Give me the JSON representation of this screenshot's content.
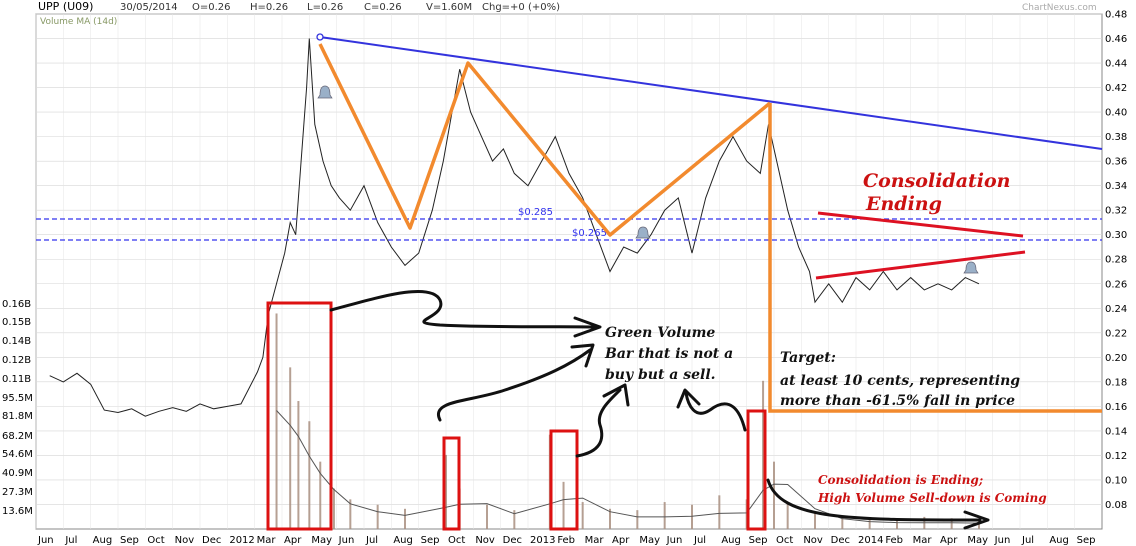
{
  "header": {
    "ticker": "UPP (U09)",
    "date": "30/05/2014",
    "open": "O=0.26",
    "high": "H=0.26",
    "low": "L=0.26",
    "close": "C=0.26",
    "volume": "V=1.60M",
    "change": "Chg=+0 (+0%)",
    "watermark": "ChartNexus.com",
    "indicator": "Volume MA (14d)"
  },
  "colors": {
    "price": "#222222",
    "volume_bar": "#a98f80",
    "volume_ma": "#555555",
    "trendline": "#3333dd",
    "support_line": "#3333ee",
    "pattern": "#f28a2e",
    "triangle": "#dd1122",
    "highlight_box": "#dd1111",
    "arrow": "#111111",
    "annotation_red": "#cc1111"
  },
  "annotations": {
    "level_285": "$0.285",
    "level_265": "$0.265",
    "consolidation_title_1": "Consolidation",
    "consolidation_title_2": "Ending",
    "green_volume_1": "Green Volume",
    "green_volume_2": "Bar that is not a",
    "green_volume_3": "buy but a sell.",
    "target_1": "Target:",
    "target_2": "at least 10 cents, representing",
    "target_3": "more than -61.5% fall in price",
    "bottom_note_1": "Consolidation is Ending;",
    "bottom_note_2": "High Volume Sell-down is Coming"
  },
  "chart_data": {
    "type": "line",
    "title": "UPP (U09)",
    "x_labels": [
      "Jun",
      "Jul",
      "Aug",
      "Sep",
      "Oct",
      "Nov",
      "Dec",
      "2012",
      "Mar",
      "Apr",
      "May",
      "Jun",
      "Jul",
      "Aug",
      "Sep",
      "Oct",
      "Nov",
      "Dec",
      "2013",
      "Feb",
      "Mar",
      "Apr",
      "May",
      "Jun",
      "Jul",
      "Aug",
      "Sep",
      "Oct",
      "Nov",
      "Dec",
      "2014",
      "Feb",
      "Mar",
      "Apr",
      "May",
      "Jun",
      "Jul",
      "Aug",
      "Sep"
    ],
    "price_axis": {
      "ticks": [
        "0.48",
        "0.46",
        "0.44",
        "0.42",
        "0.40",
        "0.38",
        "0.36",
        "0.34",
        "0.32",
        "0.30",
        "0.28",
        "0.26",
        "0.24",
        "0.22",
        "0.20",
        "0.18",
        "0.16",
        "0.14",
        "0.12",
        "0.10",
        "0.08"
      ],
      "ylim": [
        0.06,
        0.48
      ]
    },
    "volume_axis": {
      "ticks": [
        "0.16B",
        "0.15B",
        "0.14B",
        "0.12B",
        "0.11B",
        "95.5M",
        "81.8M",
        "68.2M",
        "54.6M",
        "40.9M",
        "27.3M",
        "13.6M"
      ],
      "ylim": [
        0,
        170
      ]
    },
    "price_series": [
      {
        "x": 0,
        "y": 0.185
      },
      {
        "x": 0.5,
        "y": 0.18
      },
      {
        "x": 1,
        "y": 0.187
      },
      {
        "x": 1.5,
        "y": 0.178
      },
      {
        "x": 2,
        "y": 0.157
      },
      {
        "x": 2.5,
        "y": 0.155
      },
      {
        "x": 3,
        "y": 0.158
      },
      {
        "x": 3.5,
        "y": 0.152
      },
      {
        "x": 4,
        "y": 0.156
      },
      {
        "x": 4.5,
        "y": 0.159
      },
      {
        "x": 5,
        "y": 0.156
      },
      {
        "x": 5.5,
        "y": 0.162
      },
      {
        "x": 6,
        "y": 0.158
      },
      {
        "x": 6.5,
        "y": 0.16
      },
      {
        "x": 7,
        "y": 0.162
      },
      {
        "x": 7.3,
        "y": 0.175
      },
      {
        "x": 7.6,
        "y": 0.188
      },
      {
        "x": 7.8,
        "y": 0.2
      },
      {
        "x": 8,
        "y": 0.235
      },
      {
        "x": 8.3,
        "y": 0.26
      },
      {
        "x": 8.6,
        "y": 0.285
      },
      {
        "x": 8.8,
        "y": 0.31
      },
      {
        "x": 9,
        "y": 0.3
      },
      {
        "x": 9.2,
        "y": 0.36
      },
      {
        "x": 9.4,
        "y": 0.42
      },
      {
        "x": 9.5,
        "y": 0.46
      },
      {
        "x": 9.7,
        "y": 0.39
      },
      {
        "x": 10,
        "y": 0.36
      },
      {
        "x": 10.3,
        "y": 0.34
      },
      {
        "x": 10.6,
        "y": 0.33
      },
      {
        "x": 11,
        "y": 0.32
      },
      {
        "x": 11.5,
        "y": 0.34
      },
      {
        "x": 12,
        "y": 0.31
      },
      {
        "x": 12.5,
        "y": 0.29
      },
      {
        "x": 13,
        "y": 0.275
      },
      {
        "x": 13.5,
        "y": 0.285
      },
      {
        "x": 14,
        "y": 0.32
      },
      {
        "x": 14.4,
        "y": 0.36
      },
      {
        "x": 14.8,
        "y": 0.41
      },
      {
        "x": 15,
        "y": 0.435
      },
      {
        "x": 15.4,
        "y": 0.4
      },
      {
        "x": 15.8,
        "y": 0.38
      },
      {
        "x": 16.2,
        "y": 0.36
      },
      {
        "x": 16.6,
        "y": 0.37
      },
      {
        "x": 17,
        "y": 0.35
      },
      {
        "x": 17.5,
        "y": 0.34
      },
      {
        "x": 18,
        "y": 0.36
      },
      {
        "x": 18.5,
        "y": 0.38
      },
      {
        "x": 19,
        "y": 0.35
      },
      {
        "x": 19.5,
        "y": 0.33
      },
      {
        "x": 20,
        "y": 0.3
      },
      {
        "x": 20.5,
        "y": 0.27
      },
      {
        "x": 21,
        "y": 0.29
      },
      {
        "x": 21.5,
        "y": 0.285
      },
      {
        "x": 22,
        "y": 0.3
      },
      {
        "x": 22.5,
        "y": 0.32
      },
      {
        "x": 23,
        "y": 0.33
      },
      {
        "x": 23.5,
        "y": 0.285
      },
      {
        "x": 24,
        "y": 0.33
      },
      {
        "x": 24.5,
        "y": 0.36
      },
      {
        "x": 25,
        "y": 0.38
      },
      {
        "x": 25.5,
        "y": 0.36
      },
      {
        "x": 26,
        "y": 0.35
      },
      {
        "x": 26.3,
        "y": 0.39
      },
      {
        "x": 26.6,
        "y": 0.36
      },
      {
        "x": 27,
        "y": 0.32
      },
      {
        "x": 27.4,
        "y": 0.29
      },
      {
        "x": 27.8,
        "y": 0.27
      },
      {
        "x": 28,
        "y": 0.245
      },
      {
        "x": 28.5,
        "y": 0.26
      },
      {
        "x": 29,
        "y": 0.245
      },
      {
        "x": 29.5,
        "y": 0.265
      },
      {
        "x": 30,
        "y": 0.255
      },
      {
        "x": 30.5,
        "y": 0.27
      },
      {
        "x": 31,
        "y": 0.255
      },
      {
        "x": 31.5,
        "y": 0.265
      },
      {
        "x": 32,
        "y": 0.255
      },
      {
        "x": 32.5,
        "y": 0.26
      },
      {
        "x": 33,
        "y": 0.255
      },
      {
        "x": 33.5,
        "y": 0.265
      },
      {
        "x": 34,
        "y": 0.26
      }
    ],
    "volume_bars": [
      {
        "x": 8.3,
        "v": 160
      },
      {
        "x": 8.8,
        "v": 120
      },
      {
        "x": 9.1,
        "v": 95
      },
      {
        "x": 9.5,
        "v": 80
      },
      {
        "x": 9.9,
        "v": 50
      },
      {
        "x": 10.4,
        "v": 30
      },
      {
        "x": 11,
        "v": 22
      },
      {
        "x": 12,
        "v": 18
      },
      {
        "x": 13,
        "v": 15
      },
      {
        "x": 14.5,
        "v": 55
      },
      {
        "x": 15,
        "v": 30
      },
      {
        "x": 16,
        "v": 18
      },
      {
        "x": 17,
        "v": 14
      },
      {
        "x": 18.3,
        "v": 70
      },
      {
        "x": 18.8,
        "v": 35
      },
      {
        "x": 19.5,
        "v": 20
      },
      {
        "x": 20.5,
        "v": 15
      },
      {
        "x": 21.5,
        "v": 14
      },
      {
        "x": 22.5,
        "v": 20
      },
      {
        "x": 23.5,
        "v": 18
      },
      {
        "x": 24.5,
        "v": 25
      },
      {
        "x": 25.5,
        "v": 22
      },
      {
        "x": 26.1,
        "v": 110
      },
      {
        "x": 26.5,
        "v": 50
      },
      {
        "x": 27,
        "v": 20
      },
      {
        "x": 28,
        "v": 12
      },
      {
        "x": 29,
        "v": 10
      },
      {
        "x": 30,
        "v": 8
      },
      {
        "x": 31,
        "v": 8
      },
      {
        "x": 32,
        "v": 9
      },
      {
        "x": 33,
        "v": 8
      },
      {
        "x": 34,
        "v": 7
      }
    ],
    "levels": [
      0.285,
      0.265
    ],
    "target_level": 0.1
  }
}
